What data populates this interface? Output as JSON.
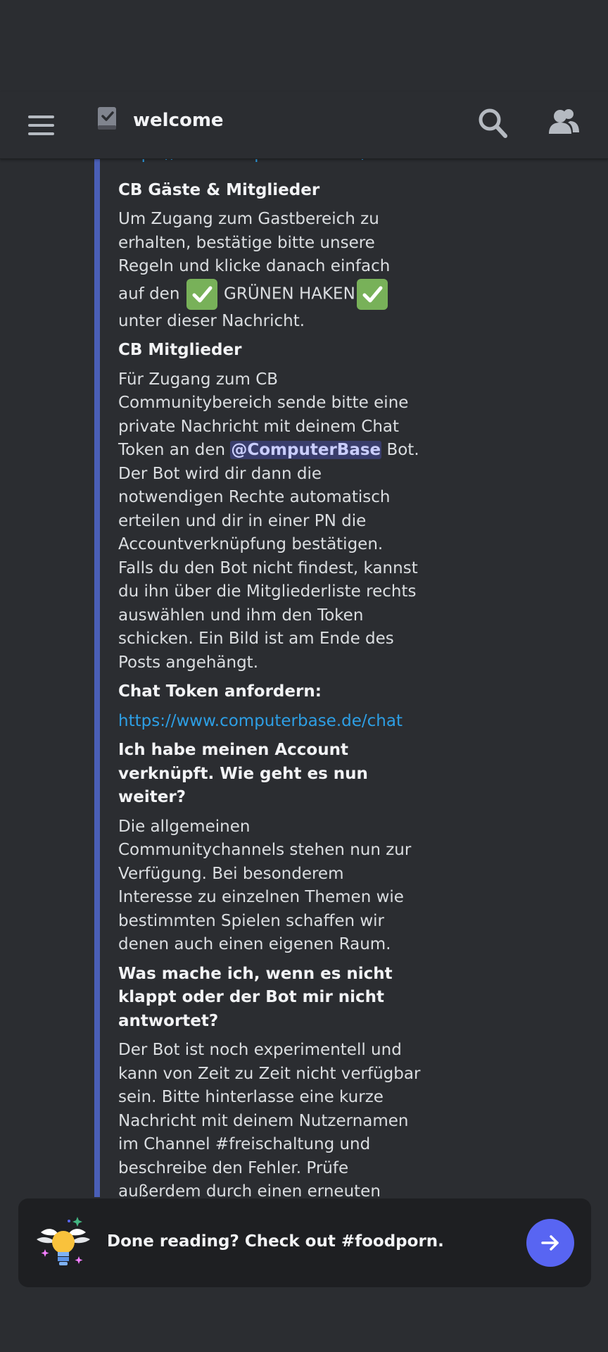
{
  "header": {
    "channel_name": "welcome",
    "menu_icon": "hamburger-menu-icon",
    "channel_icon": "rules-book-icon",
    "search_icon": "search-icon",
    "members_icon": "members-icon"
  },
  "embed": {
    "accent_color": "#4a5fb7",
    "top_link": "https://www.computerbase.de/forum",
    "fields": [
      {
        "name": "CB Gäste & Mitglieder",
        "value_part1": "Um Zugang zum Gastbereich zu erhalten, bestätige bitte unsere Regeln und klicke danach einfach auf den",
        "value_part2": "GRÜNEN HAKEN",
        "value_part3": "unter dieser Nachricht."
      },
      {
        "name": "CB Mitglieder",
        "value_part1": "Für Zugang zum CB Communitybereich sende bitte eine private Nachricht mit deinem Chat Token an den",
        "mention": "@ComputerBase",
        "value_part2": "Bot. Der Bot wird dir dann die notwendigen Rechte automatisch erteilen und dir in einer PN die Accountverknüpfung bestätigen. Falls du den Bot nicht findest, kannst du ihn über die Mitgliederliste rechts auswählen und ihm den Token schicken. Ein Bild ist am Ende des Posts angehängt."
      },
      {
        "name": "Chat Token anfordern:",
        "link": "https://www.computerbase.de/chat"
      },
      {
        "name": "Ich habe meinen Account verknüpft. Wie geht es nun weiter?",
        "value": "Die allgemeinen Communitychannels stehen nun zur Verfügung. Bei besonderem Interesse zu einzelnen Themen wie bestimmten Spielen schaffen wir denen auch einen eigenen Raum."
      },
      {
        "name": "Was mache ich, wenn es nicht klappt oder der Bot mir nicht antwortet?",
        "value": "Der Bot ist noch experimentell und kann von Zeit zu Zeit nicht verfügbar sein. Bitte hinterlasse eine kurze Nachricht mit deinem Nutzernamen im Channel #freischaltung und beschreibe den Fehler. Prüfe außerdem durch einen erneuten Klick auf \"Chat Token anfordern\", ob die Verknüpfung erfolgreich war."
      }
    ],
    "checkmark_emoji": "white-check-mark-emoji"
  },
  "bottom_card": {
    "text": "Done reading? Check out #foodporn.",
    "icon": "winged-lightbulb-icon",
    "button_icon": "arrow-right-icon",
    "button_color": "#5865f2"
  }
}
